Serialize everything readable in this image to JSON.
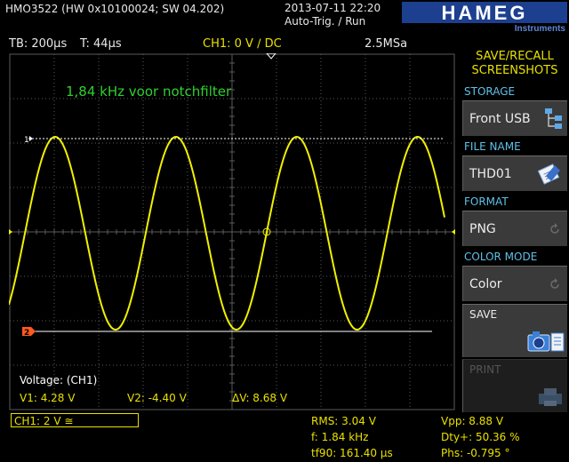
{
  "header": {
    "model": "HMO3522 (HW 0x10100024; SW 04.202)",
    "datetime": "2013-07-11 22:20",
    "trigger": "Auto-Trig. / Run",
    "brand": "HAMEG",
    "brand_sub": "Instruments"
  },
  "status": {
    "timebase": "TB: 200µs",
    "trigger_time": "T: 44µs",
    "channel": "CH1: 0 V ∕ DC",
    "sample_rate": "2.5MSa"
  },
  "plot": {
    "annotation": "1,84 kHz voor notchfilter",
    "marker_ref": "1",
    "marker_ch": "1",
    "marker_trigger": "2",
    "cursor_title": "Voltage: (CH1)",
    "cursor_v1": "V1: 4.28 V",
    "cursor_v2": "V2: -4.40 V",
    "cursor_dv": "ΔV: 8.68 V"
  },
  "menu": {
    "title_line1": "SAVE/RECALL",
    "title_line2": "SCREENSHOTS",
    "storage_label": "STORAGE",
    "storage_value": "Front USB",
    "filename_label": "FILE NAME",
    "filename_value": "THD01",
    "format_label": "FORMAT",
    "format_value": "PNG",
    "color_label": "COLOR MODE",
    "color_value": "Color",
    "save_label": "SAVE",
    "print_label": "PRINT"
  },
  "bottom": {
    "ch1_setting": "CH1: 2 V ≅",
    "rms": "RMS: 3.04 V",
    "freq": "f: 1.84 kHz",
    "tf90": "tf90: 161.40 µs",
    "vpp": "Vpp: 8.88 V",
    "duty": "Dty+: 50.36 %",
    "phase": "Phs: -0.795 °"
  },
  "colors": {
    "trace": "#f0f000",
    "grid": "#5a5a5a",
    "accent": "#e8e000",
    "section": "#5fc0e8",
    "annotation": "#2fd02f",
    "trigger_marker": "#ff5a1e"
  },
  "chart_data": {
    "type": "line",
    "waveform": "sine",
    "frequency_khz": 1.84,
    "vmax": 4.28,
    "vmin": -4.4,
    "volts_per_div": 2,
    "time_per_div_us": 200
  }
}
